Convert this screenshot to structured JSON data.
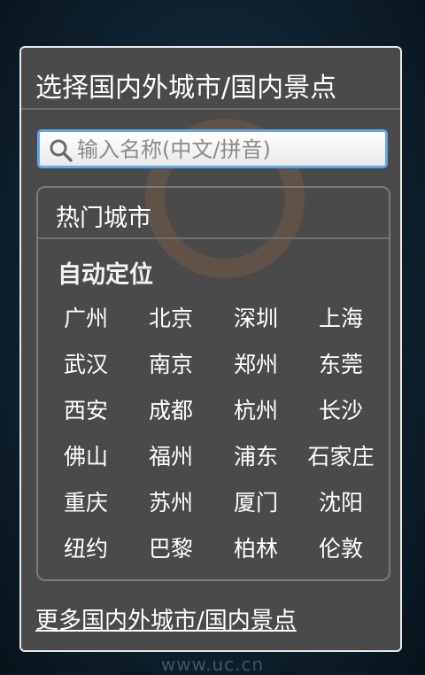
{
  "dialog": {
    "title": "选择国内外城市/国内景点",
    "search_placeholder": "输入名称(中文/拼音)",
    "hot_cities_header": "热门城市",
    "auto_locate_label": "自动定位",
    "cities": [
      "广州",
      "北京",
      "深圳",
      "上海",
      "武汉",
      "南京",
      "郑州",
      "东莞",
      "西安",
      "成都",
      "杭州",
      "长沙",
      "佛山",
      "福州",
      "浦东",
      "石家庄",
      "重庆",
      "苏州",
      "厦门",
      "沈阳",
      "纽约",
      "巴黎",
      "柏林",
      "伦敦"
    ],
    "more_link": "更多国内外城市/国内景点"
  },
  "background": {
    "watermark_text": "www.uc.cn"
  },
  "colors": {
    "dialog_bg": "#4a4a4a",
    "search_focus_border": "#5fa8ee",
    "text": "#ffffff"
  },
  "icons": [
    "search-icon"
  ]
}
